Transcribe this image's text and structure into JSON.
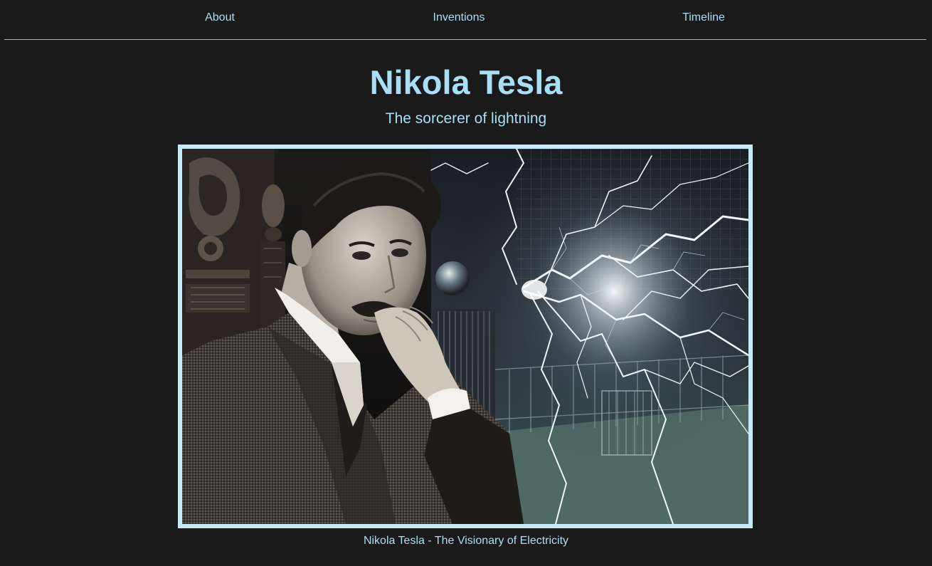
{
  "nav": {
    "items": [
      {
        "label": "About"
      },
      {
        "label": "Inventions"
      },
      {
        "label": "Timeline"
      }
    ]
  },
  "hero": {
    "title": "Nikola Tesla",
    "subtitle": "The sorcerer of lightning"
  },
  "figure": {
    "caption": "Nikola Tesla - The Visionary of Electricity"
  },
  "colors": {
    "background": "#1a1a1a",
    "accent": "#a9dff4",
    "frame": "#c5ebf6"
  }
}
